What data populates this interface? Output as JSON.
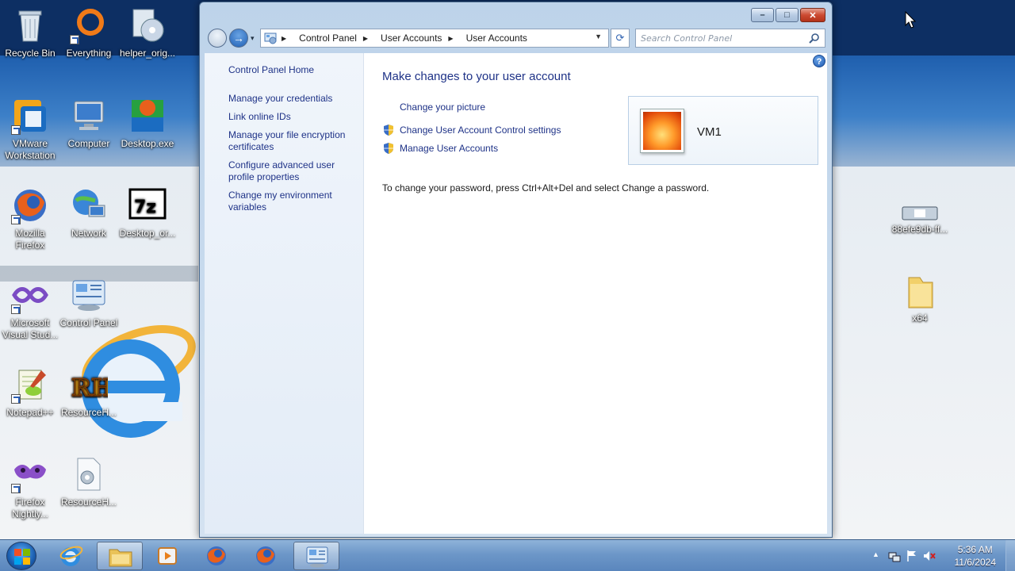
{
  "desktop_icons": [
    {
      "label": "Recycle Bin",
      "icon": "recycle-bin-icon"
    },
    {
      "label": "Everything",
      "icon": "everything-icon"
    },
    {
      "label": "helper_orig...",
      "icon": "disc-installer-icon"
    },
    {
      "label": "VMware Workstation",
      "icon": "vmware-icon"
    },
    {
      "label": "Computer",
      "icon": "computer-icon"
    },
    {
      "label": "Desktop.exe",
      "icon": "desktop-exe-icon"
    },
    {
      "label": "Mozilla Firefox",
      "icon": "firefox-icon"
    },
    {
      "label": "Network",
      "icon": "network-icon"
    },
    {
      "label": "Desktop_or...",
      "icon": "7zip-icon"
    },
    {
      "label": "Microsoft Visual Stud...",
      "icon": "visual-studio-icon"
    },
    {
      "label": "Control Panel",
      "icon": "control-panel-icon"
    },
    {
      "label": "Notepad++",
      "icon": "notepadpp-icon"
    },
    {
      "label": "ResourceH...",
      "icon": "resource-hacker-icon"
    },
    {
      "label": "Firefox Nightly...",
      "icon": "firefox-nightly-icon"
    },
    {
      "label": "ResourceH...",
      "icon": "resource-file-icon"
    }
  ],
  "right_icons": [
    {
      "label": "88efe9db-ff...",
      "icon": "drive-icon"
    },
    {
      "label": "x64",
      "icon": "folder-icon"
    }
  ],
  "window": {
    "buttons": {
      "minimize": "–",
      "maximize": "□",
      "close": "✕"
    },
    "nav": {
      "back_icon": "back-arrow-icon",
      "forward_label": "→",
      "dropdown": "▾"
    },
    "address": {
      "crumbs": [
        "Control Panel",
        "User Accounts",
        "User Accounts"
      ],
      "separator": "▶",
      "dropdown": "▼"
    },
    "refresh_label": "⟳",
    "search": {
      "placeholder": "Search Control Panel"
    },
    "help_label": "?"
  },
  "left_pane": {
    "home": "Control Panel Home",
    "links": [
      "Manage your credentials",
      "Link online IDs",
      "Manage your file encryption certificates",
      "Configure advanced user profile properties",
      "Change my environment variables"
    ]
  },
  "main": {
    "title": "Make changes to your user account",
    "links": [
      "Change your picture",
      "Change User Account Control settings",
      "Manage User Accounts"
    ],
    "note": "To change your password, press Ctrl+Alt+Del and select Change a password.",
    "user": {
      "name": "VM1"
    }
  },
  "taskbar": {
    "apps": [
      "internet-explorer-icon",
      "file-explorer-icon",
      "media-player-icon",
      "firefox-icon",
      "firefox-icon",
      "control-panel-icon"
    ],
    "clock": {
      "time": "5:36 AM",
      "date": "11/6/2024"
    },
    "tray_show_hidden": "▲"
  }
}
